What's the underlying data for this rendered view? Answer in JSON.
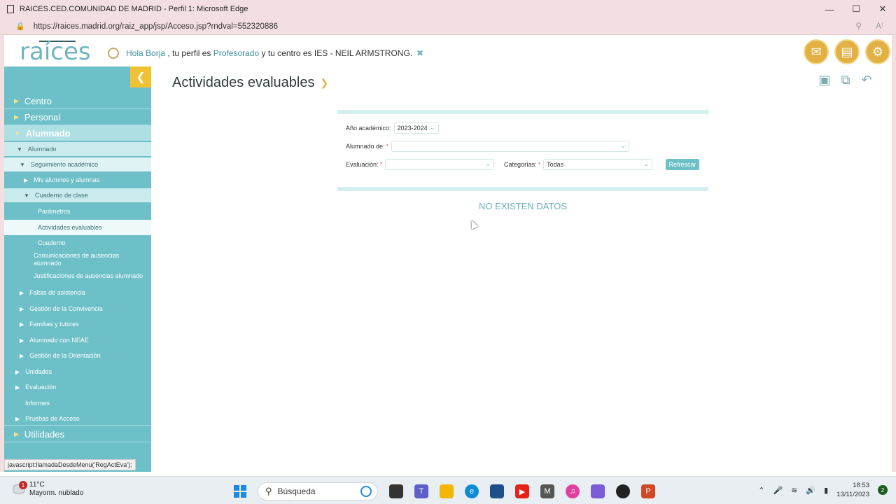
{
  "window": {
    "title": "RAICES.CED.COMUNIDAD DE MADRID - Perfil 1: Microsoft Edge",
    "url": "https://raices.madrid.org/raiz_app/jsp/Acceso.jsp?rndval=552320886"
  },
  "header": {
    "logo": "raíces",
    "greeting_prefix": "Hola",
    "user_name": "Borja",
    "profile_text": ", tu perfil es",
    "profile": "Profesorado",
    "center_text": "y tu centro es IES",
    "center_name": "- NEIL ARMSTRONG."
  },
  "sidebar": {
    "items": [
      {
        "label": "Centro"
      },
      {
        "label": "Personal"
      },
      {
        "label": "Alumnado"
      },
      {
        "label": "Alumnado"
      },
      {
        "label": "Seguimiento académico"
      },
      {
        "label": "Mis alumnos y alumnas"
      },
      {
        "label": "Cuaderno de clase"
      },
      {
        "label": "Parámetros"
      },
      {
        "label": "Actividades evaluables"
      },
      {
        "label": "Cuaderno"
      },
      {
        "label": "Comunicaciones de ausencias alumnado"
      },
      {
        "label": "Justificaciones de ausencias alumnado"
      },
      {
        "label": "Faltas de asistencia"
      },
      {
        "label": "Gestión de la Convivencia"
      },
      {
        "label": "Familias y tutores"
      },
      {
        "label": "Alumnado con NEAE"
      },
      {
        "label": "Gestión de la Orientación"
      },
      {
        "label": "Unidades"
      },
      {
        "label": "Evaluación"
      },
      {
        "label": "Informes"
      },
      {
        "label": "Pruebas de Acceso"
      },
      {
        "label": "Utilidades"
      }
    ]
  },
  "main": {
    "title": "Actividades evaluables",
    "form": {
      "year_label": "Año académico:",
      "year_value": "2023-2024",
      "students_label": "Alumnado de:",
      "students_value": "",
      "evaluation_label": "Evaluación:",
      "evaluation_value": "",
      "categories_label": "Categorías:",
      "categories_value": "Todas",
      "required_mark": "*",
      "refresh_label": "Refrescar"
    },
    "no_data": "NO EXISTEN DATOS"
  },
  "status_link": "javascript:llamadaDesdeMenu('RegActEva');",
  "taskbar": {
    "weather_badge": "1",
    "temperature": "11°C",
    "weather_desc": "Mayorm. nublado",
    "search_placeholder": "Búsqueda",
    "time": "18:53",
    "date": "13/11/2023",
    "notifications": "2"
  }
}
